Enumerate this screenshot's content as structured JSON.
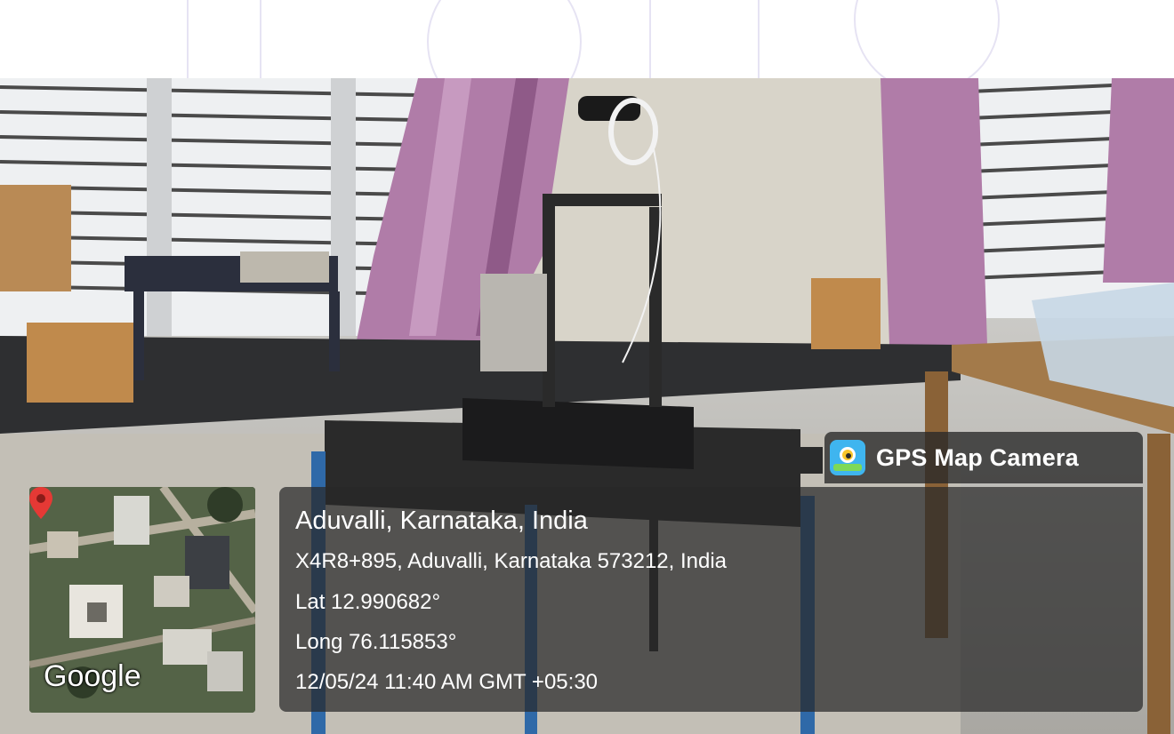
{
  "badge": {
    "title": "GPS Map Camera",
    "icon": "gps-map-camera-icon"
  },
  "location": {
    "place": "Aduvalli, Karnataka, India",
    "address": "X4R8+895, Aduvalli, Karnataka 573212, India",
    "latitude": "Lat 12.990682°",
    "longitude": "Long 76.115853°",
    "datetime": "12/05/24 11:40 AM GMT +05:30"
  },
  "map": {
    "provider_label": "Google",
    "pin_color": "#e53935"
  },
  "colors": {
    "overlay": "#282828",
    "pin": "#e53935",
    "curtain": "#b07ca8"
  }
}
